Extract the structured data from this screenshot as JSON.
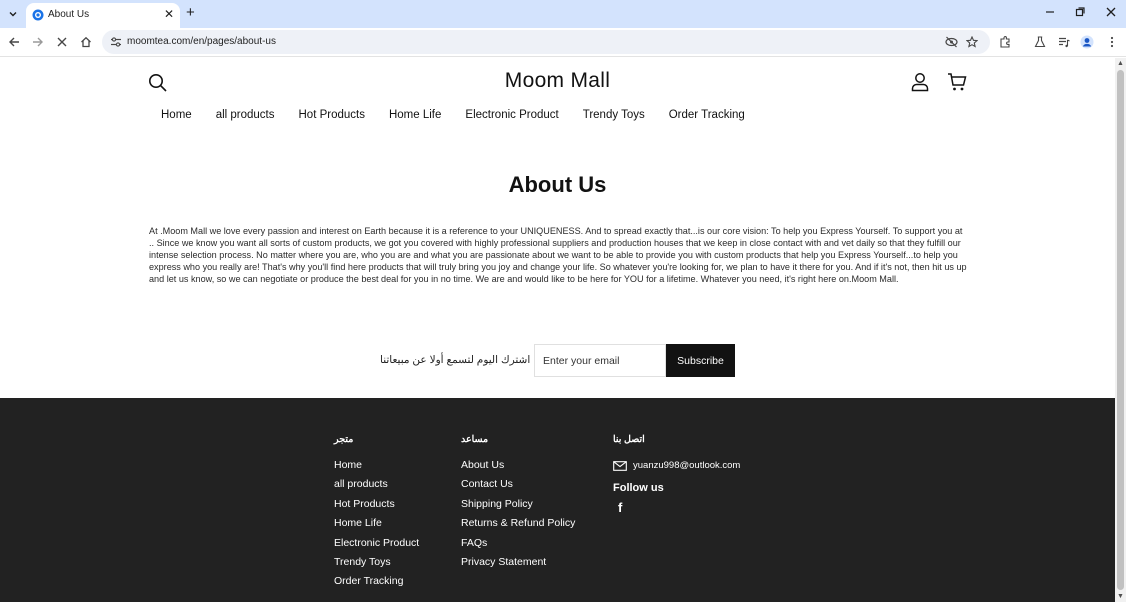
{
  "browser": {
    "tab_title": "About Us",
    "url": "moomtea.com/en/pages/about-us"
  },
  "store": {
    "name": "Moom Mall"
  },
  "nav": {
    "items": [
      "Home",
      "all products",
      "Hot Products",
      "Home Life",
      "Electronic Product",
      "Trendy Toys",
      "Order Tracking"
    ]
  },
  "about": {
    "title": "About Us",
    "body": "At .Moom Mall we love every passion and interest on Earth because it is a reference to your UNIQUENESS. And to spread exactly that...is our core vision: To help you Express Yourself. To support you at .. Since we know you want all sorts of custom products, we got you covered with highly professional suppliers and production houses that we keep in close contact with and vet daily so that they fulfill our intense selection process. No matter where you are, who you are and what you are passionate about we want to be able to provide you with custom products that help you Express Yourself...to help you express who you really are! That's why you'll find here products that will truly bring you joy and change your life. So whatever you're looking for, we plan to have it there for you. And if it's not, then hit us up and let us know, so we can negotiate or produce the best deal for you in no time. We are and would like to be here for YOU for a lifetime. Whatever you need, it's right here on.Moom Mall."
  },
  "newsletter": {
    "text": "اشترك اليوم لتسمع أولا عن مبيعاتنا",
    "placeholder": "Enter your email",
    "button": "Subscribe"
  },
  "footer": {
    "shop": {
      "heading": "متجر",
      "links": [
        "Home",
        "all products",
        "Hot Products",
        "Home Life",
        "Electronic Product",
        "Trendy Toys",
        "Order Tracking"
      ]
    },
    "help": {
      "heading": "مساعد",
      "links": [
        "About Us",
        "Contact Us",
        "Shipping Policy",
        "Returns & Refund Policy",
        "FAQs",
        "Privacy Statement"
      ]
    },
    "contact": {
      "heading": "اتصل بنا",
      "email": "yuanzu998@outlook.com",
      "follow": "Follow us",
      "facebook_glyph": "f"
    }
  },
  "colors": {
    "footer_bg": "#222222",
    "button_bg": "#121212",
    "tabbar_bg": "#d3e3fd"
  }
}
